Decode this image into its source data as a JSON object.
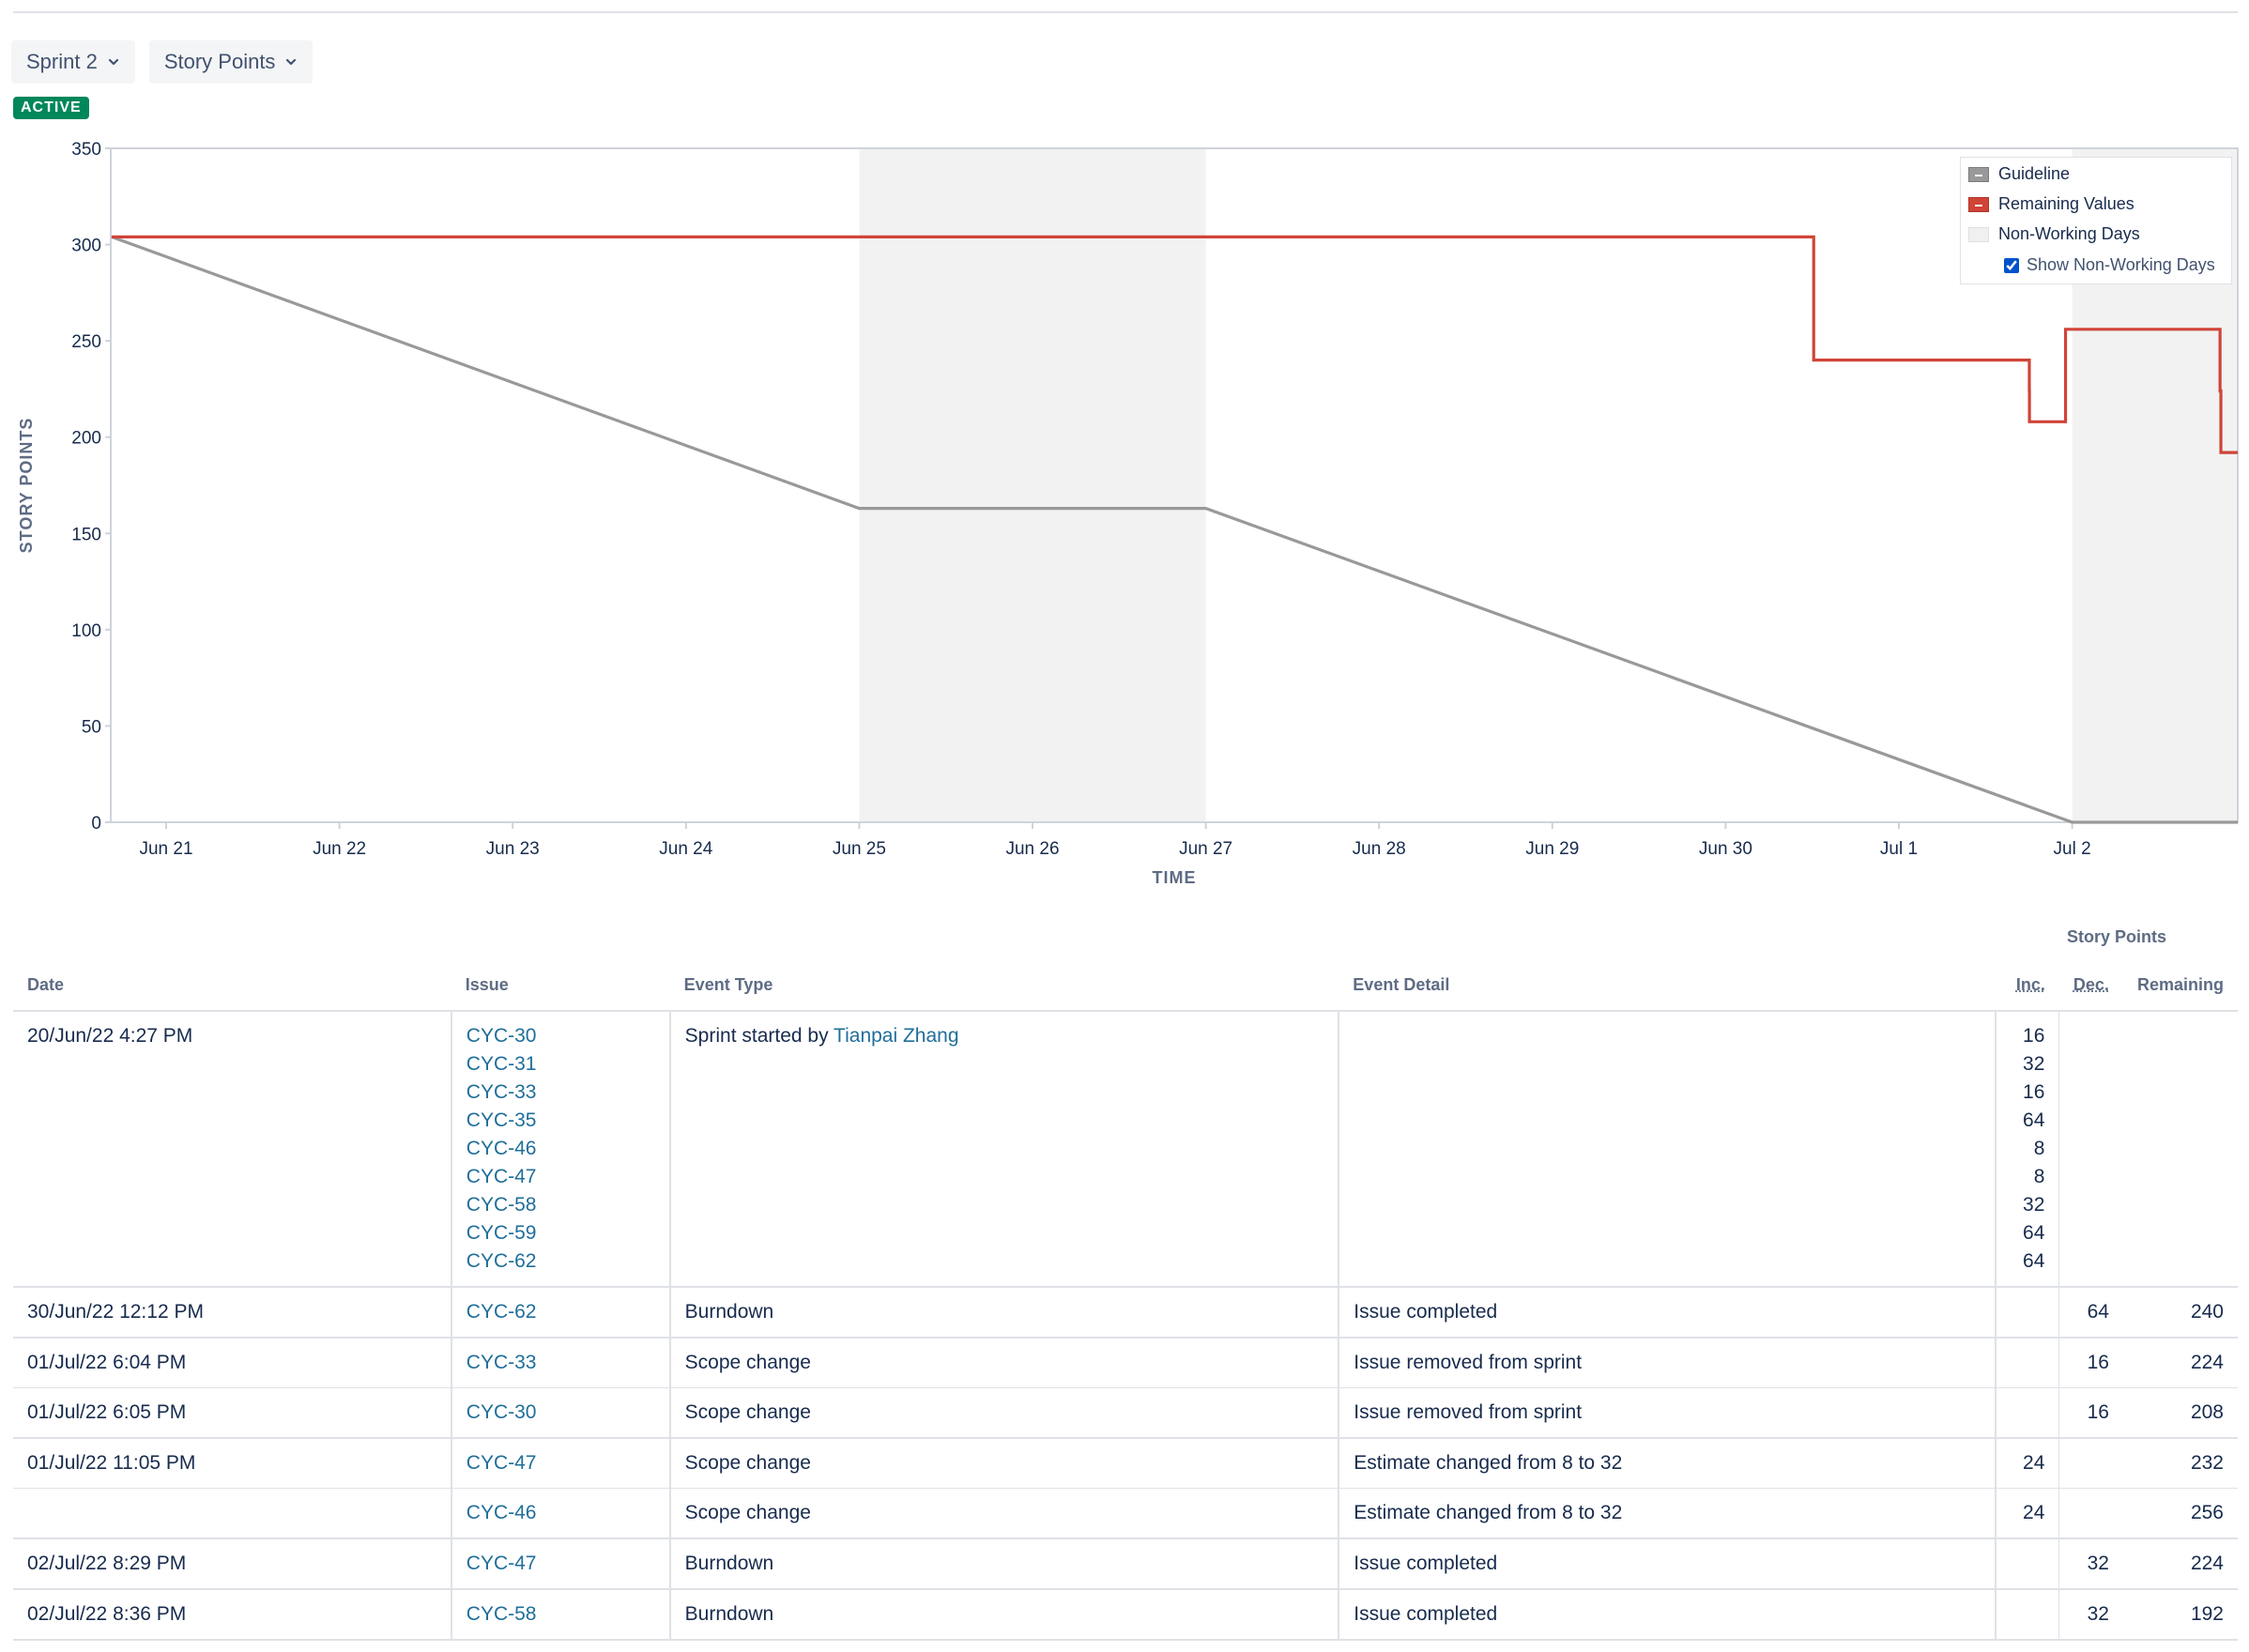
{
  "controls": {
    "sprint_label": "Sprint 2",
    "estimate_label": "Story Points",
    "status_badge": "ACTIVE"
  },
  "legend": {
    "guideline": "Guideline",
    "remaining": "Remaining Values",
    "non_working": "Non-Working Days",
    "show_non_working": "Show Non-Working Days",
    "show_non_working_checked": true
  },
  "colors": {
    "guideline": "#999999",
    "remaining": "#d04437",
    "non_working_fill": "#f2f2f2",
    "link": "#1f6e9a",
    "badge": "#00875a"
  },
  "chart_data": {
    "type": "line",
    "title": "",
    "xlabel": "TIME",
    "ylabel": "STORY POINTS",
    "ylim": [
      0,
      350
    ],
    "yticks": [
      0,
      50,
      100,
      150,
      200,
      250,
      300,
      350
    ],
    "x_ticks": [
      "Jun 21",
      "Jun 22",
      "Jun 23",
      "Jun 24",
      "Jun 25",
      "Jun 26",
      "Jun 27",
      "Jun 28",
      "Jun 29",
      "Jun 30",
      "Jul 1",
      "Jul 2"
    ],
    "xlim": [
      "2022-06-20T16:27",
      "2022-07-02T23:59"
    ],
    "non_working_days": [
      [
        "2022-06-25T00:00",
        "2022-06-27T00:00"
      ],
      [
        "2022-07-02T00:00",
        "2022-07-02T23:59"
      ]
    ],
    "series": [
      {
        "name": "Guideline",
        "step": false,
        "points": [
          [
            "2022-06-20T16:27",
            304
          ],
          [
            "2022-06-25T00:00",
            163
          ],
          [
            "2022-06-27T00:00",
            163
          ],
          [
            "2022-07-02T00:00",
            0
          ],
          [
            "2022-07-02T23:59",
            0
          ]
        ]
      },
      {
        "name": "Remaining Values",
        "step": true,
        "points": [
          [
            "2022-06-20T16:27",
            304
          ],
          [
            "2022-06-30T12:12",
            240
          ],
          [
            "2022-07-01T18:04",
            224
          ],
          [
            "2022-07-01T18:05",
            208
          ],
          [
            "2022-07-01T23:05",
            232
          ],
          [
            "2022-07-01T23:05",
            256
          ],
          [
            "2022-07-02T20:29",
            224
          ],
          [
            "2022-07-02T20:36",
            192
          ],
          [
            "2022-07-02T23:59",
            192
          ]
        ]
      }
    ]
  },
  "table": {
    "group_header": "Story Points",
    "columns": {
      "date": "Date",
      "issue": "Issue",
      "event_type": "Event Type",
      "event_detail": "Event Detail",
      "inc": "Inc.",
      "dec": "Dec.",
      "remaining": "Remaining"
    },
    "sprint_start": {
      "date": "20/Jun/22 4:27 PM",
      "event_prefix": "Sprint started by ",
      "user": "Tianpai Zhang",
      "issues": [
        "CYC-30",
        "CYC-31",
        "CYC-33",
        "CYC-35",
        "CYC-46",
        "CYC-47",
        "CYC-58",
        "CYC-59",
        "CYC-62"
      ],
      "inc": [
        "16",
        "32",
        "16",
        "64",
        "8",
        "8",
        "32",
        "64",
        "64"
      ]
    },
    "rows": [
      {
        "date": "30/Jun/22 12:12 PM",
        "issue": "CYC-62",
        "type": "Burndown",
        "detail": "Issue completed",
        "inc": "",
        "dec": "64",
        "remaining": "240"
      },
      {
        "date": "01/Jul/22 6:04 PM",
        "issue": "CYC-33",
        "type": "Scope change",
        "detail": "Issue removed from sprint",
        "inc": "",
        "dec": "16",
        "remaining": "224"
      },
      {
        "date": "01/Jul/22 6:05 PM",
        "issue": "CYC-30",
        "type": "Scope change",
        "detail": "Issue removed from sprint",
        "inc": "",
        "dec": "16",
        "remaining": "208"
      },
      {
        "date": "01/Jul/22 11:05 PM",
        "issue": "CYC-47",
        "type": "Scope change",
        "detail": "Estimate changed from 8 to 32",
        "inc": "24",
        "dec": "",
        "remaining": "232"
      },
      {
        "date": "",
        "issue": "CYC-46",
        "type": "Scope change",
        "detail": "Estimate changed from 8 to 32",
        "inc": "24",
        "dec": "",
        "remaining": "256"
      },
      {
        "date": "02/Jul/22 8:29 PM",
        "issue": "CYC-47",
        "type": "Burndown",
        "detail": "Issue completed",
        "inc": "",
        "dec": "32",
        "remaining": "224"
      },
      {
        "date": "02/Jul/22 8:36 PM",
        "issue": "CYC-58",
        "type": "Burndown",
        "detail": "Issue completed",
        "inc": "",
        "dec": "32",
        "remaining": "192"
      }
    ]
  }
}
